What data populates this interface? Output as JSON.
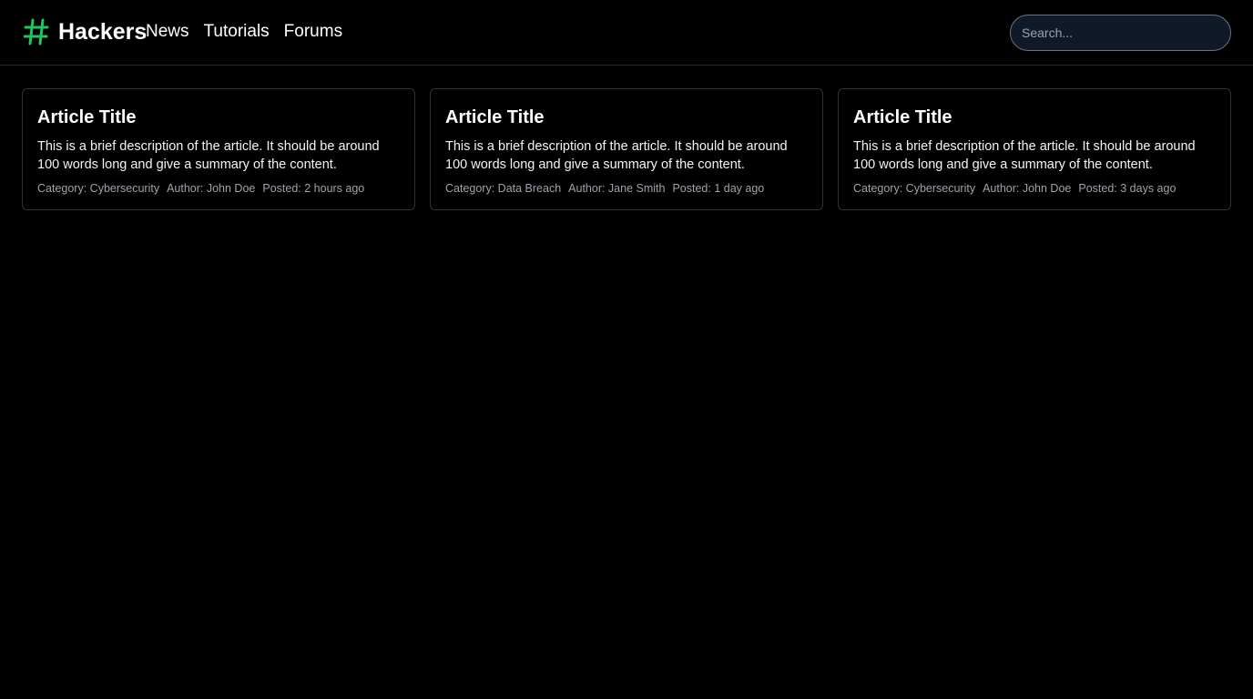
{
  "header": {
    "brand": "Hackers",
    "brand_icon": "hash-icon",
    "brand_color": "#22c55e",
    "nav": [
      {
        "label": "News"
      },
      {
        "label": "Tutorials"
      },
      {
        "label": "Forums"
      }
    ],
    "search": {
      "placeholder": "Search...",
      "value": ""
    }
  },
  "articles": [
    {
      "title": "Article Title",
      "description": "This is a brief description of the article. It should be around 100 words long and give a summary of the content.",
      "category": "Category: Cybersecurity",
      "author": "Author: John Doe",
      "posted": "Posted: 2 hours ago"
    },
    {
      "title": "Article Title",
      "description": "This is a brief description of the article. It should be around 100 words long and give a summary of the content.",
      "category": "Category: Data Breach",
      "author": "Author: Jane Smith",
      "posted": "Posted: 1 day ago"
    },
    {
      "title": "Article Title",
      "description": "This is a brief description of the article. It should be around 100 words long and give a summary of the content.",
      "category": "Category: Cybersecurity",
      "author": "Author: John Doe",
      "posted": "Posted: 3 days ago"
    }
  ]
}
